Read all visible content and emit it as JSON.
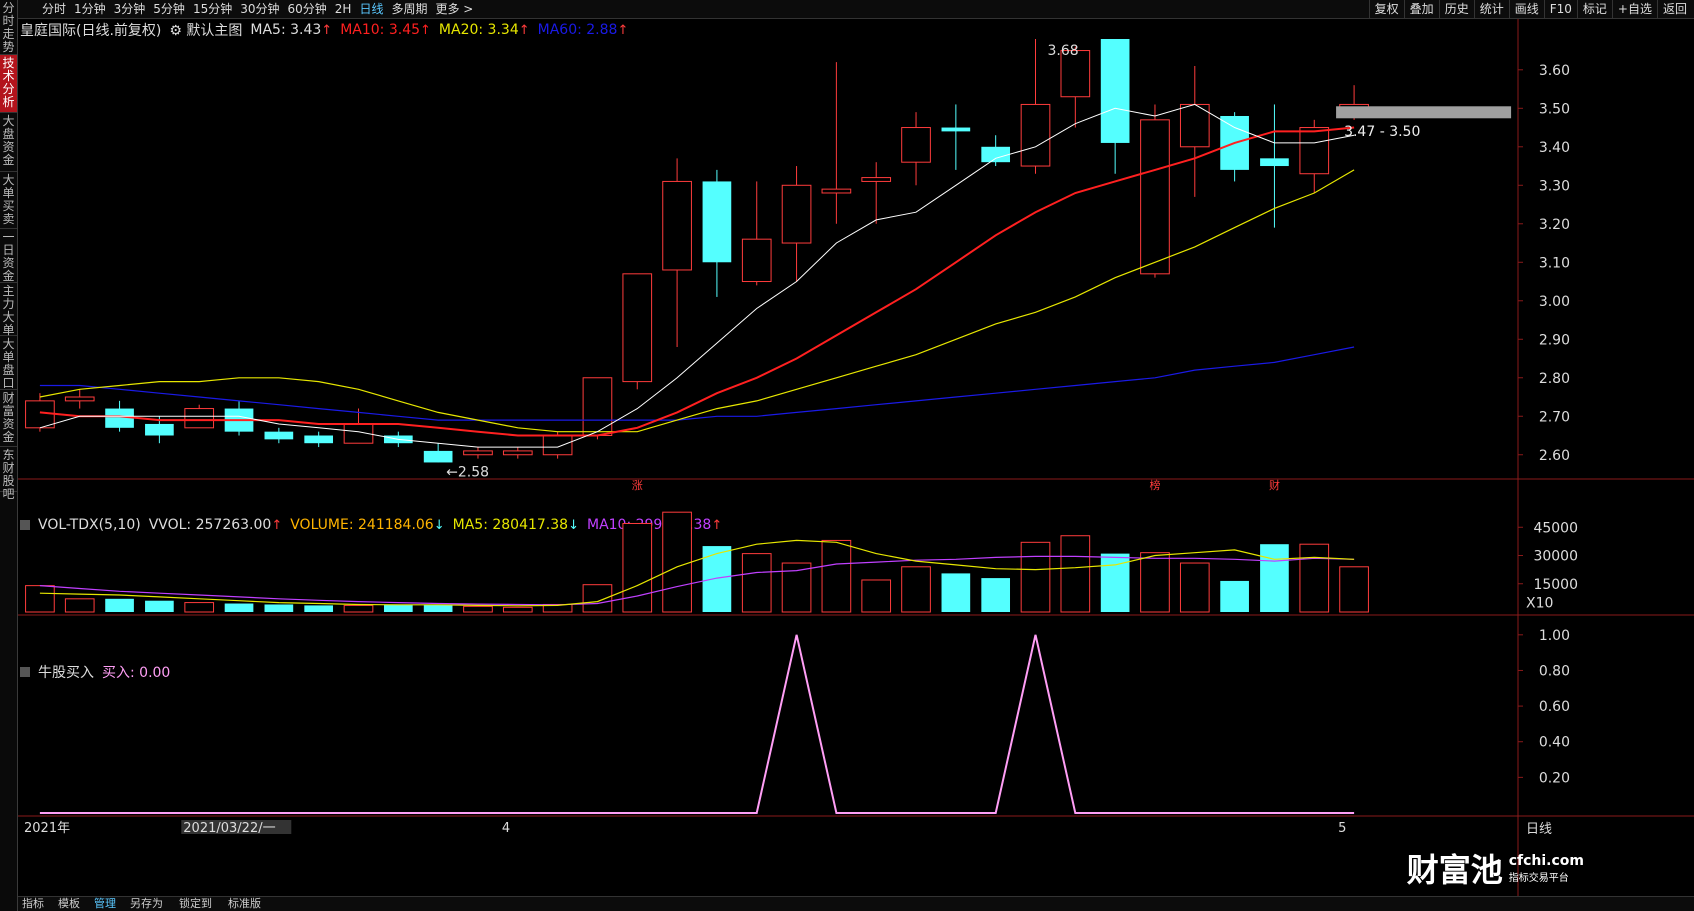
{
  "sidebar": {
    "items": [
      {
        "label": "分时走势",
        "active": false
      },
      {
        "label": "技术分析",
        "active": true
      },
      {
        "label": "大盘资金",
        "active": false
      },
      {
        "label": "大单买卖",
        "active": false
      },
      {
        "label": "一日资金",
        "active": false
      },
      {
        "label": "主力大单",
        "active": false
      },
      {
        "label": "大单盘口",
        "active": false
      },
      {
        "label": "财富资金",
        "active": false
      },
      {
        "label": "东财股吧",
        "active": false
      }
    ]
  },
  "toolbar": {
    "periods": [
      "分时",
      "1分钟",
      "3分钟",
      "5分钟",
      "15分钟",
      "30分钟",
      "60分钟",
      "2H",
      "日线",
      "多周期",
      "更多 >"
    ],
    "active_period": "日线",
    "right_tools": [
      "复权",
      "叠加",
      "历史",
      "统计",
      "画线",
      "F10",
      "标记",
      "+自选",
      "返回"
    ]
  },
  "main_legend": {
    "title": "皇庭国际(日线.前复权)",
    "template": "默认主图",
    "ma5": "MA5: 3.43",
    "ma10": "MA10: 3.45",
    "ma20": "MA20: 3.34",
    "ma60": "MA60: 2.88",
    "arrow": "↑"
  },
  "vol_legend": {
    "name": "VOL-TDX(5,10)",
    "vvol": "VVOL: 257263.00",
    "volume": "VOLUME: 241184.06",
    "ma5": "MA5: 280417.38",
    "ma10": "MA10: 299448.38",
    "arr_up": "↑",
    "arr_down": "↓"
  },
  "ind_legend": {
    "name": "牛股买入",
    "value": "买入: 0.00"
  },
  "colors": {
    "up": "#ff3c3c",
    "down": "#54ffff",
    "ma5": "#ffffff",
    "ma10": "#ff2020",
    "ma20": "#e6e600",
    "ma60": "#1a1ae6",
    "volma10": "#c040ff",
    "signal": "#ff9ef5"
  },
  "chart_data": [
    {
      "type": "candlestick",
      "title": "皇庭国际(日线.前复权)",
      "ylim": [
        2.55,
        3.68
      ],
      "yticks": [
        "3.60",
        "3.50",
        "3.40",
        "3.30",
        "3.20",
        "3.10",
        "3.00",
        "2.90",
        "2.80",
        "2.70",
        "2.60"
      ],
      "yticks_v": [
        3.6,
        3.5,
        3.4,
        3.3,
        3.2,
        3.1,
        3.0,
        2.9,
        2.8,
        2.7,
        2.6
      ],
      "candles": [
        {
          "o": 2.67,
          "c": 2.74,
          "h": 2.76,
          "l": 2.66
        },
        {
          "o": 2.74,
          "c": 2.75,
          "h": 2.77,
          "l": 2.72
        },
        {
          "o": 2.72,
          "c": 2.67,
          "h": 2.74,
          "l": 2.66
        },
        {
          "o": 2.68,
          "c": 2.65,
          "h": 2.7,
          "l": 2.63
        },
        {
          "o": 2.67,
          "c": 2.72,
          "h": 2.73,
          "l": 2.67
        },
        {
          "o": 2.72,
          "c": 2.66,
          "h": 2.74,
          "l": 2.65
        },
        {
          "o": 2.66,
          "c": 2.64,
          "h": 2.67,
          "l": 2.63
        },
        {
          "o": 2.65,
          "c": 2.63,
          "h": 2.66,
          "l": 2.62
        },
        {
          "o": 2.63,
          "c": 2.68,
          "h": 2.72,
          "l": 2.63
        },
        {
          "o": 2.65,
          "c": 2.63,
          "h": 2.66,
          "l": 2.62
        },
        {
          "o": 2.61,
          "c": 2.58,
          "h": 2.63,
          "l": 2.58
        },
        {
          "o": 2.6,
          "c": 2.61,
          "h": 2.62,
          "l": 2.59
        },
        {
          "o": 2.6,
          "c": 2.61,
          "h": 2.62,
          "l": 2.59
        },
        {
          "o": 2.6,
          "c": 2.65,
          "h": 2.66,
          "l": 2.59
        },
        {
          "o": 2.65,
          "c": 2.8,
          "h": 2.8,
          "l": 2.64
        },
        {
          "o": 2.79,
          "c": 3.07,
          "h": 3.07,
          "l": 2.77
        },
        {
          "o": 3.08,
          "c": 3.31,
          "h": 3.37,
          "l": 2.88
        },
        {
          "o": 3.31,
          "c": 3.1,
          "h": 3.34,
          "l": 3.01
        },
        {
          "o": 3.05,
          "c": 3.16,
          "h": 3.31,
          "l": 3.04
        },
        {
          "o": 3.15,
          "c": 3.3,
          "h": 3.35,
          "l": 3.05
        },
        {
          "o": 3.28,
          "c": 3.29,
          "h": 3.62,
          "l": 3.2
        },
        {
          "o": 3.31,
          "c": 3.32,
          "h": 3.36,
          "l": 3.2
        },
        {
          "o": 3.36,
          "c": 3.45,
          "h": 3.49,
          "l": 3.3
        },
        {
          "o": 3.45,
          "c": 3.44,
          "h": 3.51,
          "l": 3.34
        },
        {
          "o": 3.4,
          "c": 3.36,
          "h": 3.43,
          "l": 3.35
        },
        {
          "o": 3.35,
          "c": 3.51,
          "h": 3.68,
          "l": 3.33
        },
        {
          "o": 3.53,
          "c": 3.65,
          "h": 3.66,
          "l": 3.45
        },
        {
          "o": 3.68,
          "c": 3.41,
          "h": 3.68,
          "l": 3.33
        },
        {
          "o": 3.07,
          "c": 3.47,
          "h": 3.51,
          "l": 3.06
        },
        {
          "o": 3.4,
          "c": 3.51,
          "h": 3.61,
          "l": 3.27
        },
        {
          "o": 3.48,
          "c": 3.34,
          "h": 3.49,
          "l": 3.31
        },
        {
          "o": 3.37,
          "c": 3.35,
          "h": 3.51,
          "l": 3.19
        },
        {
          "o": 3.33,
          "c": 3.45,
          "h": 3.47,
          "l": 3.28
        },
        {
          "o": 3.5,
          "c": 3.51,
          "h": 3.56,
          "l": 3.47
        }
      ],
      "ma5": [
        2.67,
        2.7,
        2.7,
        2.7,
        2.7,
        2.7,
        2.68,
        2.67,
        2.66,
        2.64,
        2.63,
        2.62,
        2.62,
        2.62,
        2.66,
        2.72,
        2.8,
        2.89,
        2.98,
        3.05,
        3.15,
        3.21,
        3.23,
        3.3,
        3.37,
        3.4,
        3.46,
        3.5,
        3.48,
        3.51,
        3.45,
        3.41,
        3.41,
        3.43
      ],
      "ma10": [
        2.71,
        2.7,
        2.7,
        2.69,
        2.69,
        2.69,
        2.69,
        2.68,
        2.68,
        2.68,
        2.67,
        2.66,
        2.65,
        2.65,
        2.65,
        2.67,
        2.71,
        2.76,
        2.8,
        2.85,
        2.91,
        2.97,
        3.03,
        3.1,
        3.17,
        3.23,
        3.28,
        3.31,
        3.34,
        3.37,
        3.41,
        3.44,
        3.44,
        3.45
      ],
      "ma20": [
        2.75,
        2.77,
        2.78,
        2.79,
        2.79,
        2.8,
        2.8,
        2.79,
        2.77,
        2.74,
        2.71,
        2.69,
        2.67,
        2.66,
        2.66,
        2.66,
        2.69,
        2.72,
        2.74,
        2.77,
        2.8,
        2.83,
        2.86,
        2.9,
        2.94,
        2.97,
        3.01,
        3.06,
        3.1,
        3.14,
        3.19,
        3.24,
        3.28,
        3.34
      ],
      "ma60": [
        2.78,
        2.78,
        2.77,
        2.76,
        2.75,
        2.74,
        2.73,
        2.72,
        2.71,
        2.7,
        2.69,
        2.69,
        2.69,
        2.69,
        2.69,
        2.69,
        2.69,
        2.7,
        2.7,
        2.71,
        2.72,
        2.73,
        2.74,
        2.75,
        2.76,
        2.77,
        2.78,
        2.79,
        2.8,
        2.82,
        2.83,
        2.84,
        2.86,
        2.88
      ],
      "annotations": {
        "high_label": "3.68",
        "low_label": "2.58",
        "range_label": "3.47 - 3.50"
      },
      "event_markers": [
        {
          "index": 15,
          "label": "涨"
        },
        {
          "index": 28,
          "label": "榜"
        },
        {
          "index": 31,
          "label": "财"
        }
      ]
    },
    {
      "type": "bar",
      "title": "VOL-TDX(5,10)",
      "ylim": [
        0,
        60000
      ],
      "yticks": [
        "45000",
        "30000",
        "15000"
      ],
      "yticks_v": [
        45000,
        30000,
        15000
      ],
      "unit_label": "X10",
      "volumes": [
        14000,
        7000,
        7000,
        6000,
        5000,
        4500,
        4000,
        3500,
        3500,
        4000,
        4000,
        3000,
        2500,
        4000,
        14500,
        47000,
        53000,
        35000,
        31000,
        26000,
        38000,
        17000,
        24000,
        20500,
        18000,
        37000,
        40500,
        31000,
        31500,
        26000,
        16500,
        36000,
        36000,
        24000
      ],
      "ma5": [
        10000,
        9500,
        9000,
        8000,
        7000,
        6000,
        5000,
        4500,
        4000,
        3800,
        3800,
        3500,
        3300,
        3500,
        5500,
        14000,
        24000,
        31000,
        36000,
        38000,
        37000,
        31000,
        27000,
        25000,
        23000,
        22500,
        23500,
        25000,
        30000,
        31500,
        33000,
        28000,
        29000,
        28000
      ],
      "ma10": [
        14000,
        12500,
        11000,
        10000,
        9000,
        8000,
        7000,
        6200,
        5500,
        5000,
        4500,
        4200,
        4000,
        3800,
        4500,
        8500,
        13500,
        18000,
        21000,
        22000,
        25500,
        26500,
        27500,
        28000,
        29000,
        29500,
        29500,
        29000,
        28500,
        28500,
        28000,
        27000,
        28500,
        28000
      ]
    },
    {
      "type": "line",
      "title": "牛股买入",
      "ylim": [
        0,
        1.1
      ],
      "yticks": [
        "1.00",
        "0.80",
        "0.60",
        "0.40",
        "0.20"
      ],
      "yticks_v": [
        1.0,
        0.8,
        0.6,
        0.4,
        0.2
      ],
      "signal": [
        0,
        0,
        0,
        0,
        0,
        0,
        0,
        0,
        0,
        0,
        0,
        0,
        0,
        0,
        0,
        0,
        0,
        0,
        0,
        1,
        0,
        0,
        0,
        0,
        0,
        1,
        0,
        0,
        0,
        0,
        0,
        0,
        0,
        0
      ]
    }
  ],
  "date_axis": {
    "labels": [
      {
        "index": 0,
        "text": "2021年"
      },
      {
        "index": 4,
        "text": "2021/03/22/一",
        "highlight": true
      },
      {
        "index": 12,
        "text": "4"
      },
      {
        "index": 33,
        "text": "5"
      }
    ],
    "period_label": "日线"
  },
  "bottom_tabs": [
    "指标",
    "模板",
    "管理",
    "另存为",
    "锁定到",
    "标准版"
  ],
  "watermark": {
    "brand": "财富池",
    "url": "cfchi.com",
    "tagline": "指标交易平台"
  }
}
